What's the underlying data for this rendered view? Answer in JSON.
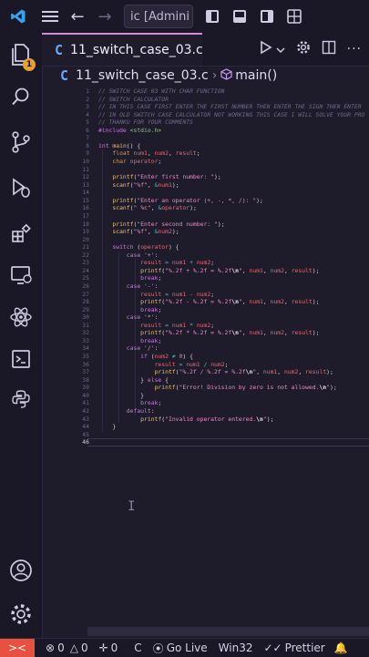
{
  "window": {
    "title": "ic [Admini"
  },
  "tab": {
    "file_letter": "C",
    "filename": "11_switch_case_03.c"
  },
  "breadcrumb": {
    "file_letter": "C",
    "file": "11_switch_case_03.c",
    "separator": "›",
    "symbol": "main()"
  },
  "editor": {
    "cursor_line": 46,
    "lines": [
      "// SWITCH CASE 03 WITH CHAR FUNCTION",
      "// SWITCH CALCULATOR",
      "// IN THIS CASE FIRST ENTER THE FIRST NUMBER THEN ENTER THE SIGN THEN ENTER",
      "// IN OLD SWITCH CASE CALCULATOR NOT WORKING THIS CASE I WILL SOLVE YOUR PRO",
      "// THANKU FOR YOUR COMMENTS",
      "#include <stdio.h>",
      "",
      "int main() {",
      "    float num1, num2, result;",
      "    char operator;",
      "",
      "    printf(\"Enter first number: \");",
      "    scanf(\"%f\", &num1);",
      "",
      "    printf(\"Enter an operator (+, -, *, /): \");",
      "    scanf(\" %c\", &operator);",
      "",
      "    printf(\"Enter second number: \");",
      "    scanf(\"%f\", &num2);",
      "",
      "    switch (operator) {",
      "        case '+':",
      "            result = num1 + num2;",
      "            printf(\"%.2f + %.2f = %.2f\\n\", num1, num2, result);",
      "            break;",
      "        case '-':",
      "            result = num1 - num2;",
      "            printf(\"%.2f - %.2f = %.2f\\n\", num1, num2, result);",
      "            break;",
      "        case '*':",
      "            result = num1 * num2;",
      "            printf(\"%.2f * %.2f = %.2f\\n\", num1, num2, result);",
      "            break;",
      "        case '/':",
      "            if (num2 ≠ 0) {",
      "                result = num1 / num2;",
      "                printf(\"%.2f / %.2f = %.2f\\n\", num1, num2, result);",
      "            } else {",
      "                printf(\"Error! Division by zero is not allowed.\\n\");",
      "            }",
      "            break;",
      "        default:",
      "            printf(\"Invalid operator entered.\\n\");",
      "    }",
      "",
      ""
    ]
  },
  "activity": {
    "badge": "1"
  },
  "status": {
    "remote_icon": "><",
    "errors": "0",
    "warnings": "0",
    "ports": "0",
    "language": "C",
    "golive": "Go Live",
    "platform": "Win32",
    "prettier": "Prettier"
  },
  "colors": {
    "accent": "#d28dd8",
    "remote": "#e8513f",
    "badge": "#e8a033",
    "c_icon": "#6aa6ff"
  }
}
